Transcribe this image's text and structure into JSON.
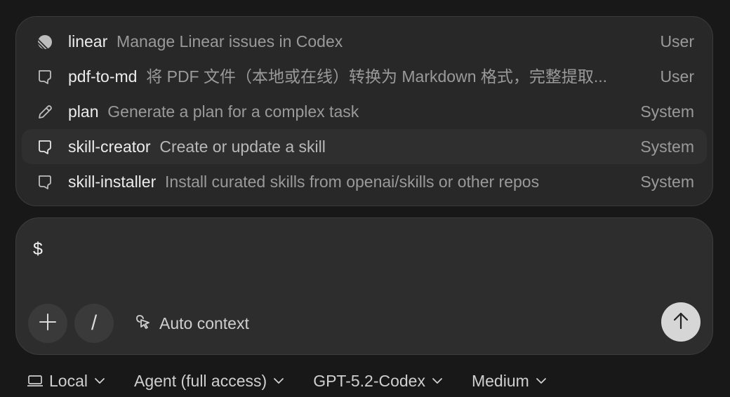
{
  "skills": [
    {
      "name": "linear",
      "description": "Manage Linear issues in Codex",
      "source": "User",
      "icon": "linear-logo-icon",
      "active": false
    },
    {
      "name": "pdf-to-md",
      "description": "将 PDF 文件（本地或在线）转换为 Markdown 格式，完整提取...",
      "source": "User",
      "icon": "skill-icon",
      "active": false
    },
    {
      "name": "plan",
      "description": "Generate a plan for a complex task",
      "source": "System",
      "icon": "pencil-icon",
      "active": false
    },
    {
      "name": "skill-creator",
      "description": "Create or update a skill",
      "source": "System",
      "icon": "skill-icon",
      "active": true
    },
    {
      "name": "skill-installer",
      "description": "Install curated skills from openai/skills or other repos",
      "source": "System",
      "icon": "skill-icon",
      "active": false
    }
  ],
  "composer": {
    "input_value": "$",
    "plus_icon": "plus-icon",
    "slash_label": "/",
    "auto_context_label": "Auto context",
    "send_icon": "arrow-up-icon"
  },
  "bottom_bar": {
    "environment": "Local",
    "mode": "Agent (full access)",
    "model": "GPT-5.2-Codex",
    "reasoning": "Medium"
  },
  "colors": {
    "background": "#181818",
    "panel": "#282828",
    "composer": "#2d2d2d",
    "send_button": "#d6d6d6"
  }
}
